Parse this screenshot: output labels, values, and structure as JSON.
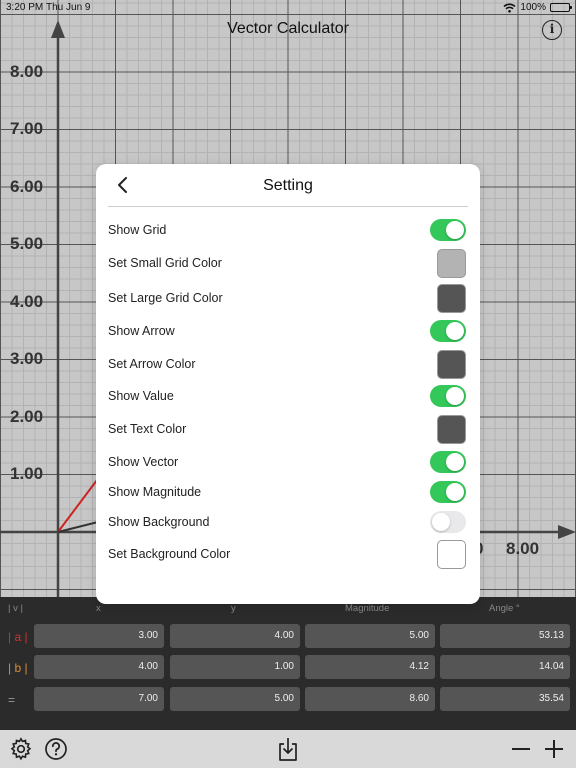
{
  "status_bar": {
    "time": "3:20 PM",
    "date": "Thu Jun 9",
    "battery": "100%"
  },
  "app": {
    "title": "Vector Calculator",
    "info_icon": "info-icon"
  },
  "plot": {
    "y_ticks": [
      "8.00",
      "7.00",
      "6.00",
      "5.00",
      "4.00",
      "3.00",
      "2.00",
      "1.00"
    ],
    "x_ticks_visible": [
      "0",
      "8.00"
    ],
    "grid_small_color": "#b3b3b3",
    "grid_large_color": "#555555",
    "vector_a_color": "#cc2222",
    "vector_b_color": "#333333"
  },
  "settings": {
    "title": "Setting",
    "back_icon": "chevron-left-icon",
    "rows": [
      {
        "label": "Show Grid",
        "type": "toggle",
        "on": true
      },
      {
        "label": "Set Small Grid Color",
        "type": "color",
        "color": "#b3b3b3"
      },
      {
        "label": "Set Large Grid Color",
        "type": "color",
        "color": "#555555"
      },
      {
        "label": "Show Arrow",
        "type": "toggle",
        "on": true
      },
      {
        "label": "Set Arrow Color",
        "type": "color",
        "color": "#555555"
      },
      {
        "label": "Show Value",
        "type": "toggle",
        "on": true
      },
      {
        "label": "Set Text Color",
        "type": "color",
        "color": "#555555"
      },
      {
        "label": "Show Vector",
        "type": "toggle",
        "on": true
      },
      {
        "label": "Show Magnitude",
        "type": "toggle",
        "on": true
      },
      {
        "label": "Show Background",
        "type": "toggle",
        "on": false
      },
      {
        "label": "Set Background Color",
        "type": "color",
        "color": "#ffffff"
      }
    ]
  },
  "table": {
    "headers": [
      "| v |",
      "x",
      "y",
      "Magnitude",
      "Angle °"
    ],
    "rows": [
      {
        "label": "| a |",
        "label_color": "#cc3333",
        "values": [
          "3.00",
          "4.00",
          "5.00",
          "53.13"
        ]
      },
      {
        "label": "| b |",
        "label_color": "#d98c3a",
        "values": [
          "4.00",
          "1.00",
          "4.12",
          "14.04"
        ]
      },
      {
        "label": "=",
        "label_color": "#999999",
        "values": [
          "7.00",
          "5.00",
          "8.60",
          "35.54"
        ]
      }
    ]
  },
  "toolbar": {
    "left_icons": [
      "gear-icon",
      "help-icon"
    ],
    "center_icon": "download-icon",
    "right_icons": [
      "minus-icon",
      "plus-icon"
    ]
  }
}
